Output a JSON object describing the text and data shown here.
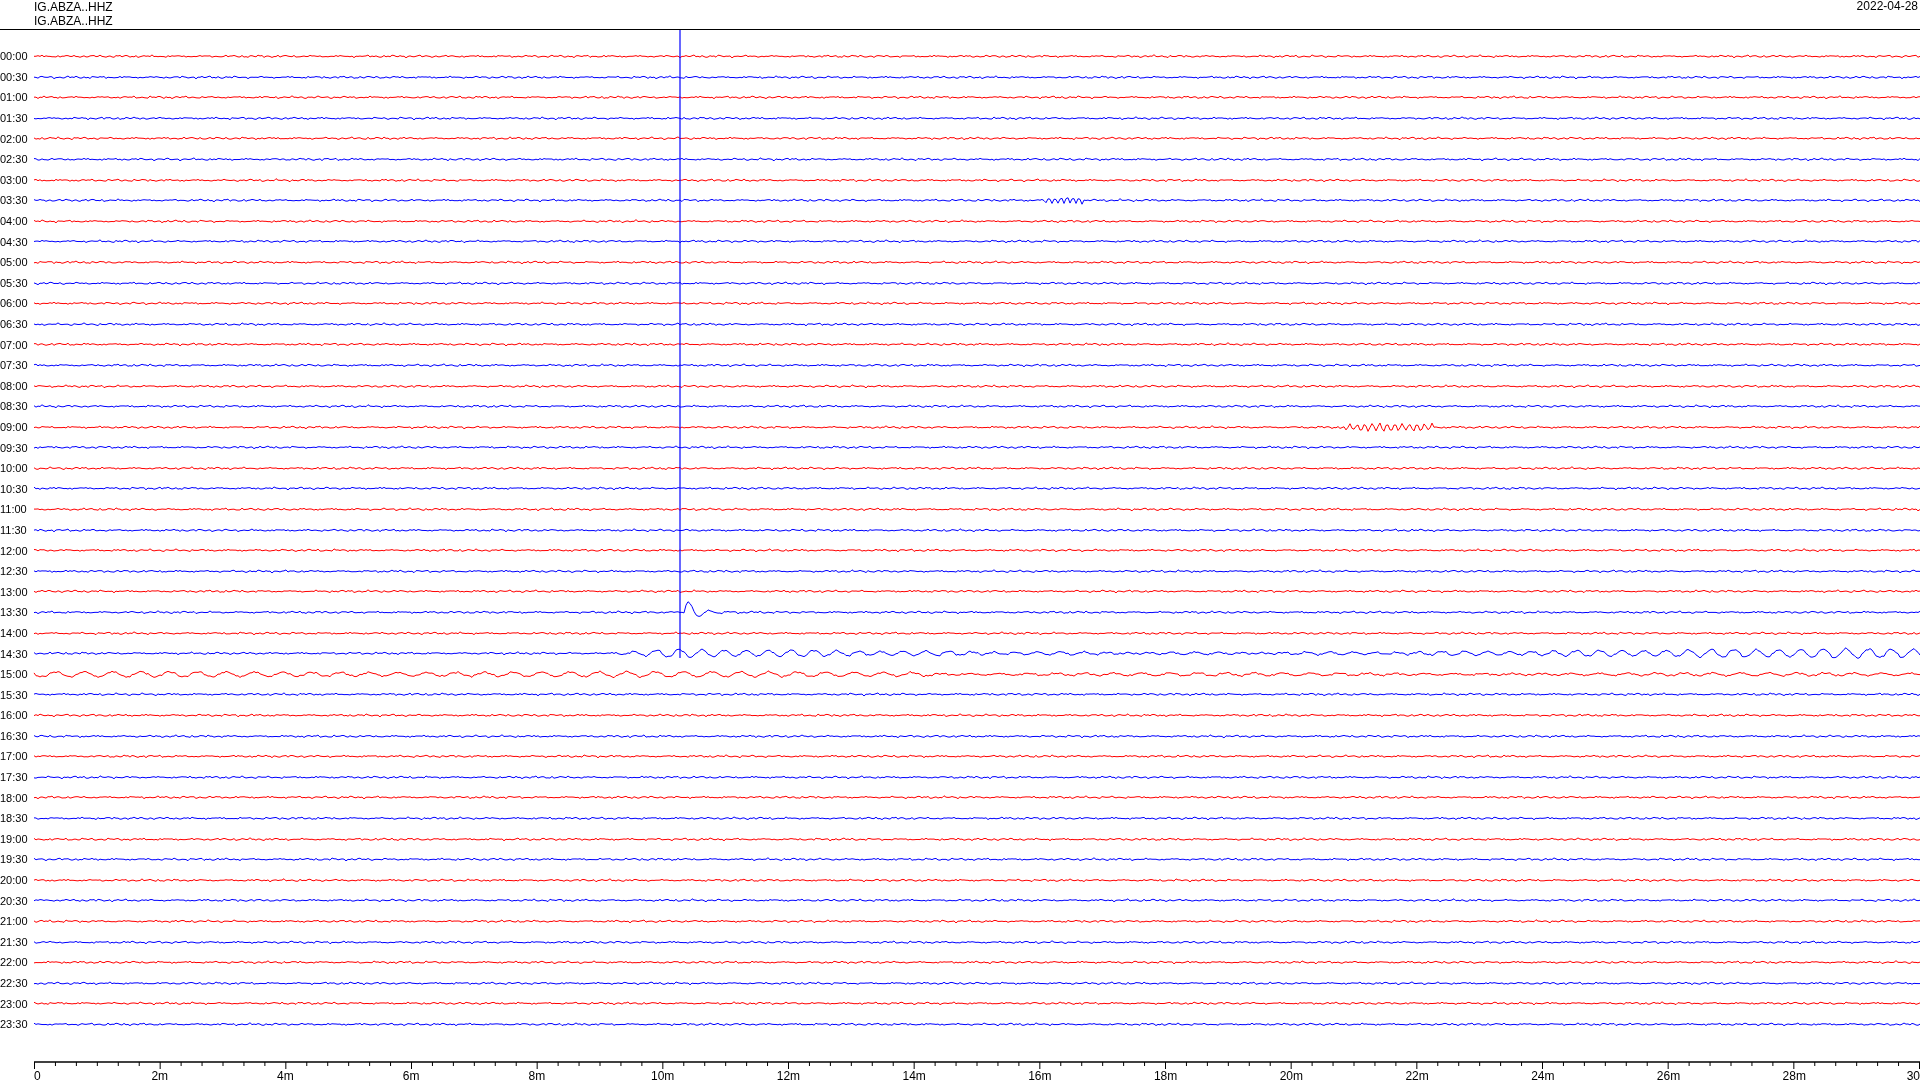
{
  "header": {
    "station_lines": [
      "IG.ABZA..HHZ",
      "IG.ABZA..HHZ"
    ],
    "date": "2022-04-28"
  },
  "traces": [
    {
      "label": "00:00",
      "color": "#ff0000"
    },
    {
      "label": "00:30",
      "color": "#0000ff"
    },
    {
      "label": "01:00",
      "color": "#ff0000"
    },
    {
      "label": "01:30",
      "color": "#0000ff"
    },
    {
      "label": "02:00",
      "color": "#ff0000"
    },
    {
      "label": "02:30",
      "color": "#0000ff"
    },
    {
      "label": "03:00",
      "color": "#ff0000"
    },
    {
      "label": "03:30",
      "color": "#0000ff"
    },
    {
      "label": "04:00",
      "color": "#ff0000"
    },
    {
      "label": "04:30",
      "color": "#0000ff"
    },
    {
      "label": "05:00",
      "color": "#ff0000"
    },
    {
      "label": "05:30",
      "color": "#0000ff"
    },
    {
      "label": "06:00",
      "color": "#ff0000"
    },
    {
      "label": "06:30",
      "color": "#0000ff"
    },
    {
      "label": "07:00",
      "color": "#ff0000"
    },
    {
      "label": "07:30",
      "color": "#0000ff"
    },
    {
      "label": "08:00",
      "color": "#ff0000"
    },
    {
      "label": "08:30",
      "color": "#0000ff"
    },
    {
      "label": "09:00",
      "color": "#ff0000"
    },
    {
      "label": "09:30",
      "color": "#0000ff"
    },
    {
      "label": "10:00",
      "color": "#ff0000"
    },
    {
      "label": "10:30",
      "color": "#0000ff"
    },
    {
      "label": "11:00",
      "color": "#ff0000"
    },
    {
      "label": "11:30",
      "color": "#0000ff"
    },
    {
      "label": "12:00",
      "color": "#ff0000"
    },
    {
      "label": "12:30",
      "color": "#0000ff"
    },
    {
      "label": "13:00",
      "color": "#ff0000"
    },
    {
      "label": "13:30",
      "color": "#0000ff"
    },
    {
      "label": "14:00",
      "color": "#ff0000"
    },
    {
      "label": "14:30",
      "color": "#0000ff"
    },
    {
      "label": "15:00",
      "color": "#ff0000"
    },
    {
      "label": "15:30",
      "color": "#0000ff"
    },
    {
      "label": "16:00",
      "color": "#ff0000"
    },
    {
      "label": "16:30",
      "color": "#0000ff"
    },
    {
      "label": "17:00",
      "color": "#ff0000"
    },
    {
      "label": "17:30",
      "color": "#0000ff"
    },
    {
      "label": "18:00",
      "color": "#ff0000"
    },
    {
      "label": "18:30",
      "color": "#0000ff"
    },
    {
      "label": "19:00",
      "color": "#ff0000"
    },
    {
      "label": "19:30",
      "color": "#0000ff"
    },
    {
      "label": "20:00",
      "color": "#ff0000"
    },
    {
      "label": "20:30",
      "color": "#0000ff"
    },
    {
      "label": "21:00",
      "color": "#ff0000"
    },
    {
      "label": "21:30",
      "color": "#0000ff"
    },
    {
      "label": "22:00",
      "color": "#ff0000"
    },
    {
      "label": "22:30",
      "color": "#0000ff"
    },
    {
      "label": "23:00",
      "color": "#ff0000"
    },
    {
      "label": "23:30",
      "color": "#0000ff"
    }
  ],
  "x_axis": {
    "tick_labels": [
      "0",
      "2m",
      "4m",
      "6m",
      "8m",
      "10m",
      "12m",
      "14m",
      "16m",
      "18m",
      "20m",
      "22m",
      "24m",
      "26m",
      "28m",
      "30"
    ]
  }
}
